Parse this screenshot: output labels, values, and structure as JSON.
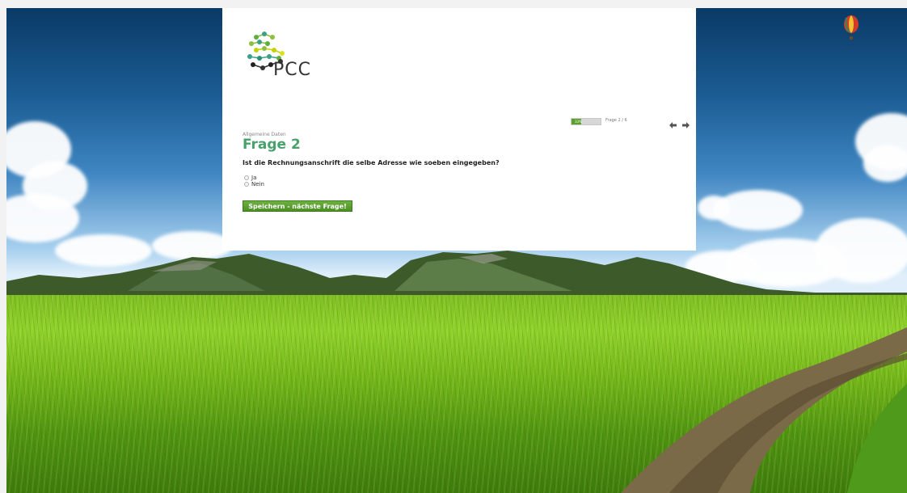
{
  "brand": {
    "logo_text": "PCC",
    "logo_icon": "pcc-molecule-logo"
  },
  "progress": {
    "percent": 33,
    "label": "33%",
    "counter": "Frage 2 / 6"
  },
  "navigation": {
    "back_icon": "arrow-left-icon",
    "forward_icon": "arrow-right-icon"
  },
  "survey": {
    "category": "Allgemeine Daten",
    "title": "Frage 2",
    "question": "Ist die Rechnungsanschrift die selbe Adresse wie soeben eingegeben?",
    "options": [
      {
        "label": "Ja"
      },
      {
        "label": "Nein"
      }
    ],
    "submit_label": "Speichern - nächste Frage!"
  },
  "colors": {
    "accent_green": "#48a06b",
    "button_green": "#5aa02c",
    "panel_background": "#ffffff"
  }
}
